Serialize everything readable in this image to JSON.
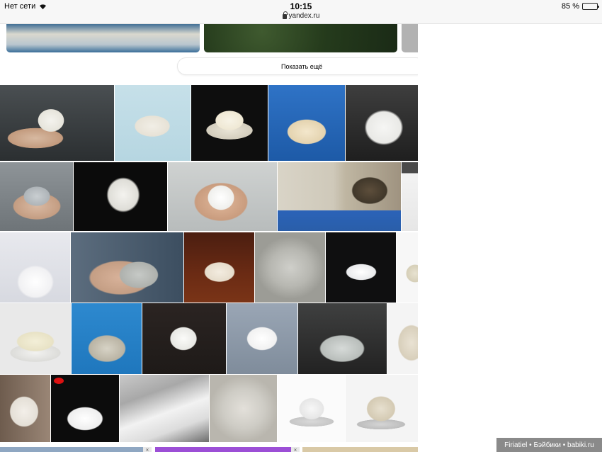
{
  "status_bar": {
    "carrier": "Нет сети",
    "time": "10:15",
    "url": "yandex.ru",
    "battery_percent": "85 %",
    "battery_level": 0.85
  },
  "results": {
    "show_more_label": "Показать ещё"
  },
  "watermark": {
    "text": "Firiatiel • Бэйбики • babiki.ru"
  },
  "ad_marks": [
    "✕",
    "✕"
  ]
}
